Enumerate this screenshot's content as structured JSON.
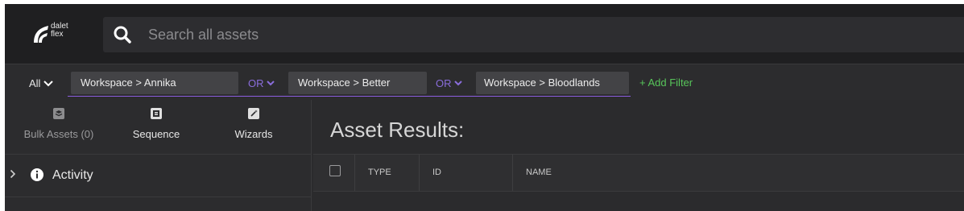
{
  "brand": {
    "logo_line1": "dalet",
    "logo_line2": "flex"
  },
  "search": {
    "placeholder": "Search all assets"
  },
  "filterbar": {
    "scope": "All",
    "filters": [
      "Workspace > Annika",
      "Workspace > Better",
      "Workspace > Bloodlands"
    ],
    "operator": "OR",
    "add_filter": "+ Add Filter"
  },
  "tools": [
    {
      "label": "Bulk Assets (0)",
      "icon": "layers-icon"
    },
    {
      "label": "Sequence",
      "icon": "film-icon"
    },
    {
      "label": "Wizards",
      "icon": "magic-wand-icon"
    }
  ],
  "activity": {
    "label": "Activity"
  },
  "results": {
    "title": "Asset Results:",
    "columns": [
      "TYPE",
      "ID",
      "NAME"
    ]
  },
  "colors": {
    "accent": "#8c5de0",
    "add_filter": "#57c55a",
    "bg": "#2b2b2d"
  }
}
